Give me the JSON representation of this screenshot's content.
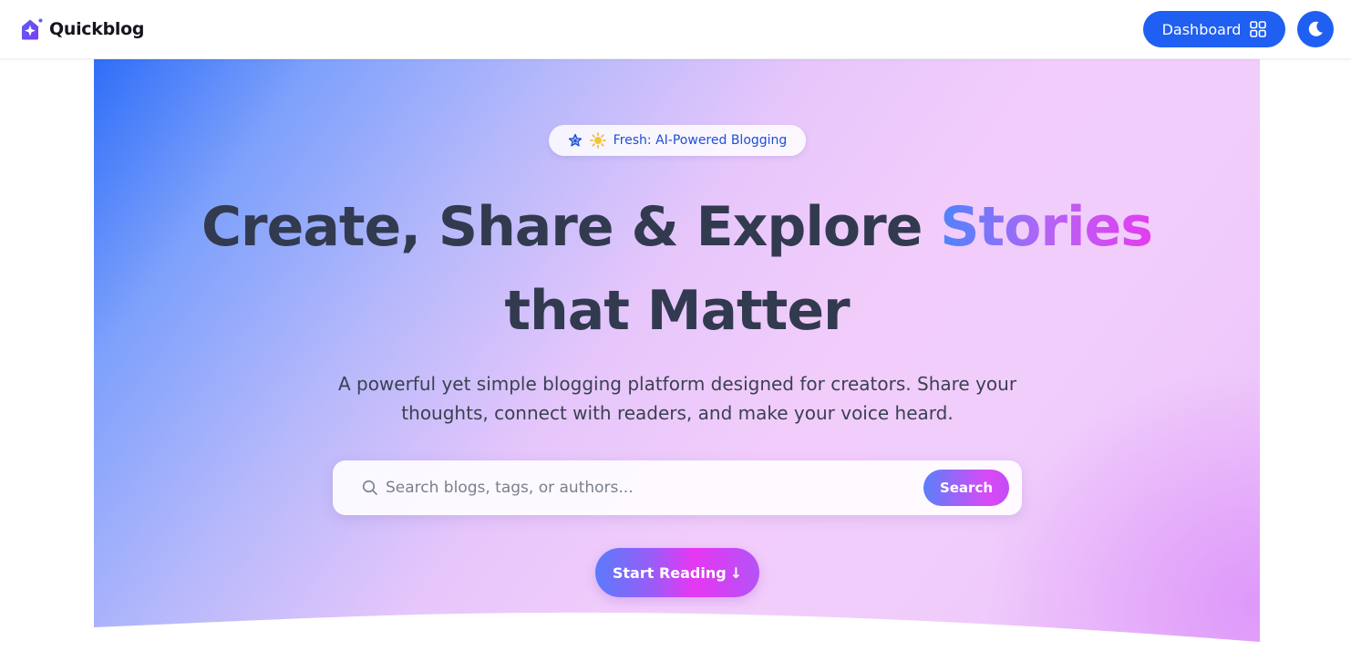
{
  "app": {
    "brand_name": "Quickblog",
    "logo_icon": "sparkle-house-icon",
    "accent_color": "#1f5ff2"
  },
  "nav": {
    "dashboard_label": "Dashboard",
    "dashboard_icon": "grid-icon",
    "theme_toggle_icon": "moon-icon"
  },
  "hero": {
    "badge": {
      "icons": [
        "star-icon",
        "sun-icon"
      ],
      "text": "Fresh: AI-Powered Blogging"
    },
    "headline": {
      "part1": "Create, Share & Explore ",
      "highlight": "Stories",
      "line2": "that Matter"
    },
    "subtext": "A powerful yet simple blogging platform designed for creators. Share your thoughts, connect with readers, and make your voice heard.",
    "search": {
      "icon": "search-icon",
      "placeholder": "Search blogs, tags, or authors...",
      "value": "",
      "button_label": "Search"
    },
    "cta": {
      "label": "Start Reading",
      "arrow": "↓"
    }
  }
}
